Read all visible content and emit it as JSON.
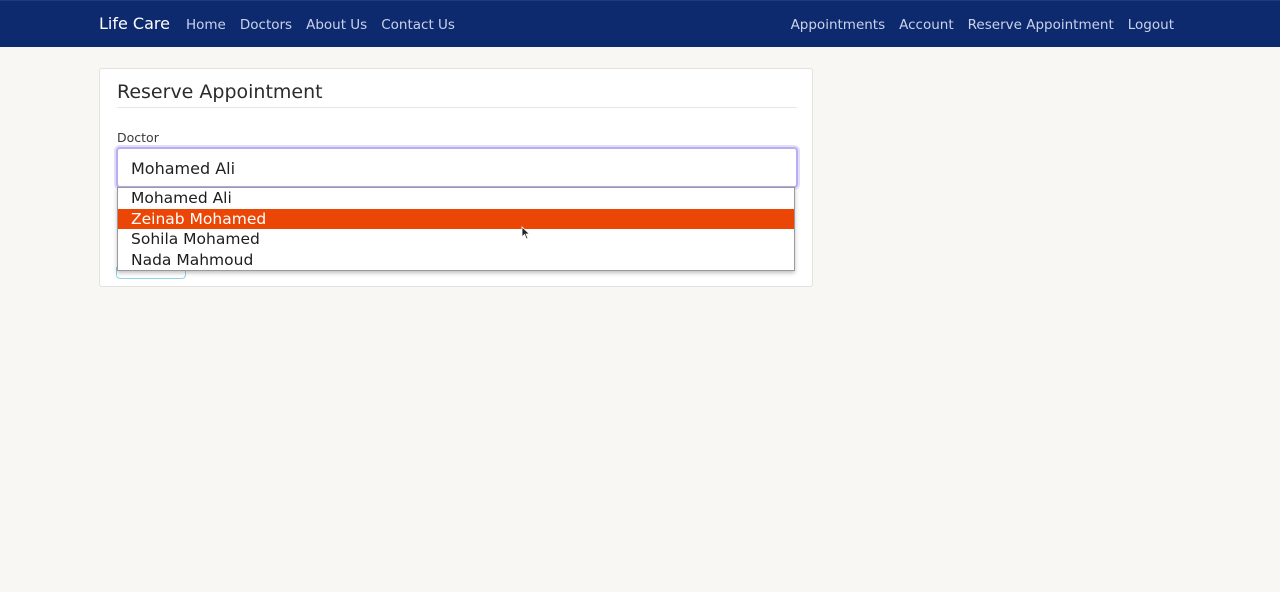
{
  "navbar": {
    "brand": "Life Care",
    "left_links": [
      "Home",
      "Doctors",
      "About Us",
      "Contact Us"
    ],
    "right_links": [
      "Appointments",
      "Account",
      "Reserve Appointment",
      "Logout"
    ],
    "background": "#0e2a6e"
  },
  "card": {
    "title": "Reserve Appointment",
    "doctor_label": "Doctor",
    "selected_doctor": "Mohamed Ali"
  },
  "dropdown": {
    "options": [
      "Mohamed Ali",
      "Zeinab Mohamed",
      "Sohila Mohamed",
      "Nada Mahmoud"
    ],
    "highlighted_option": "Zeinab Mohamed",
    "highlight_color": "#ec4606"
  }
}
